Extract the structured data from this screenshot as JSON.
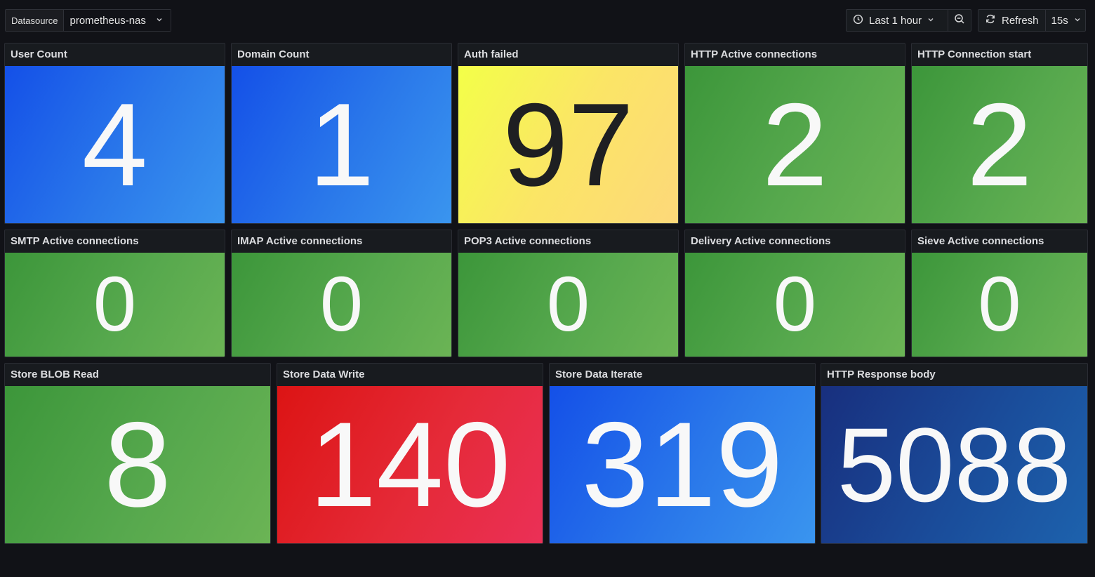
{
  "toolbar": {
    "datasource_label": "Datasource",
    "datasource_value": "prometheus-nas",
    "time_range": "Last 1 hour",
    "refresh_label": "Refresh",
    "refresh_interval": "15s"
  },
  "panels": [
    {
      "title": "User Count",
      "value": "4"
    },
    {
      "title": "Domain Count",
      "value": "1"
    },
    {
      "title": "Auth failed",
      "value": "97"
    },
    {
      "title": "HTTP Active connections",
      "value": "2"
    },
    {
      "title": "HTTP Connection start",
      "value": "2"
    },
    {
      "title": "SMTP Active connections",
      "value": "0"
    },
    {
      "title": "IMAP Active connections",
      "value": "0"
    },
    {
      "title": "POP3 Active connections",
      "value": "0"
    },
    {
      "title": "Delivery Active connections",
      "value": "0"
    },
    {
      "title": "Sieve Active connections",
      "value": "0"
    },
    {
      "title": "Store BLOB Read",
      "value": "8"
    },
    {
      "title": "Store Data Write",
      "value": "140"
    },
    {
      "title": "Store Data Iterate",
      "value": "319"
    },
    {
      "title": "HTTP Response body",
      "value": "5088"
    }
  ],
  "colors": {
    "background": "#111217",
    "blue": "#2a78ea",
    "green": "#56a84d",
    "yellow": "#fbe566",
    "red": "#e52a38",
    "navy": "#1a4c9a"
  }
}
